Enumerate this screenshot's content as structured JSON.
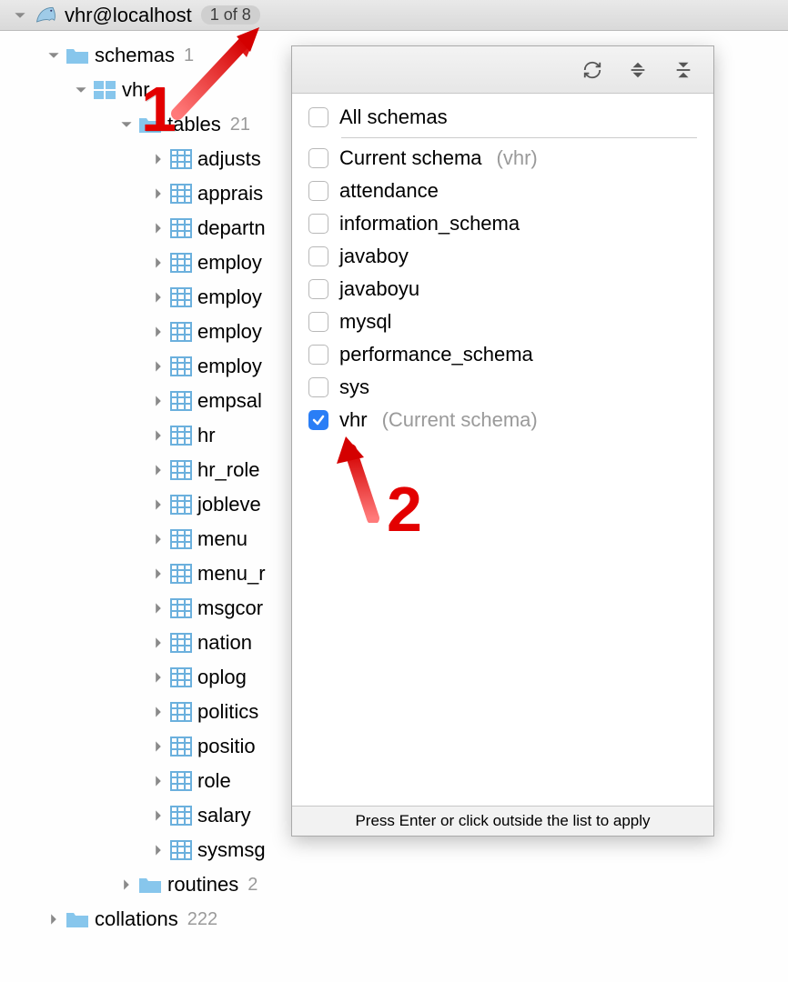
{
  "header": {
    "connection": "vhr@localhost",
    "badge": "1 of 8"
  },
  "tree": {
    "schemas_label": "schemas",
    "schemas_count": "1",
    "schema_name": "vhr",
    "tables_label": "tables",
    "tables_count": "21",
    "tables": [
      "adjusts",
      "apprais",
      "departn",
      "employ",
      "employ",
      "employ",
      "employ",
      "empsal",
      "hr",
      "hr_role",
      "jobleve",
      "menu",
      "menu_r",
      "msgcor",
      "nation",
      "oplog",
      "politics",
      "positio",
      "role",
      "salary",
      "sysmsg"
    ],
    "routines_label": "routines",
    "routines_count": "2",
    "collations_label": "collations",
    "collations_count": "222"
  },
  "popup": {
    "all_label": "All schemas",
    "current_label": "Current schema",
    "current_hint": "(vhr)",
    "items": [
      {
        "name": "attendance",
        "checked": false
      },
      {
        "name": "information_schema",
        "checked": false
      },
      {
        "name": "javaboy",
        "checked": false
      },
      {
        "name": "javaboyu",
        "checked": false
      },
      {
        "name": "mysql",
        "checked": false
      },
      {
        "name": "performance_schema",
        "checked": false
      },
      {
        "name": "sys",
        "checked": false
      },
      {
        "name": "vhr",
        "checked": true,
        "hint": "(Current schema)"
      }
    ],
    "footer": "Press Enter or click outside the list to apply"
  },
  "annotations": {
    "one": "1",
    "two": "2"
  }
}
